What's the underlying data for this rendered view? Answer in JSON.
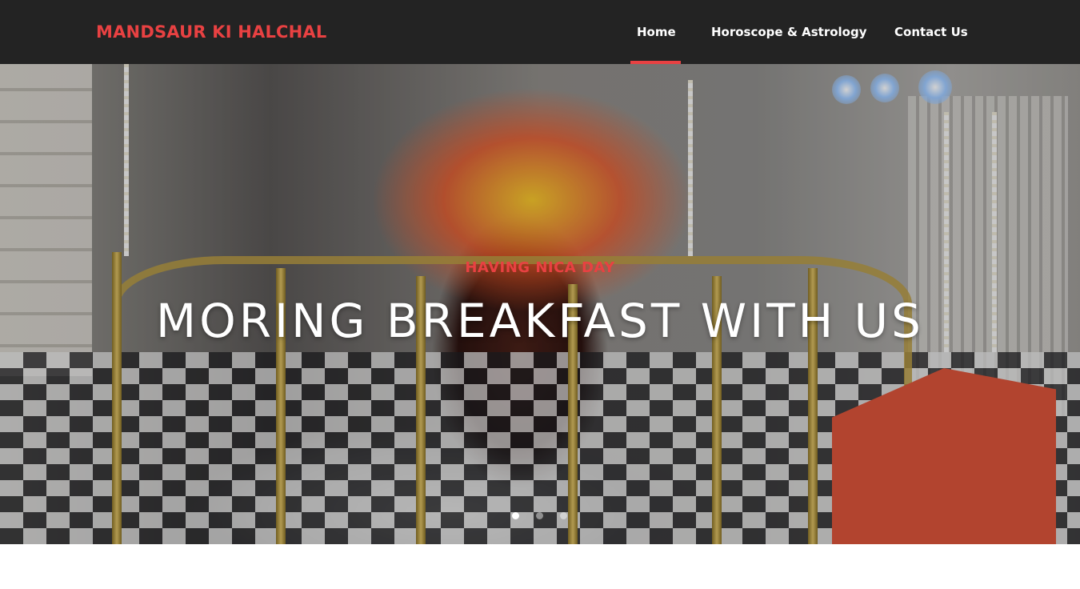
{
  "brand": {
    "name": "MANDSAUR KI HALCHAL"
  },
  "nav": {
    "items": [
      {
        "label": "Home",
        "active": true
      },
      {
        "label": "Horoscope & Astrology",
        "active": false
      },
      {
        "label": "Contact Us",
        "active": false
      }
    ]
  },
  "hero": {
    "subtitle": "Having Nica Day",
    "title": "Moring Breakfast with us",
    "slides_count": 3,
    "active_slide": 1
  },
  "colors": {
    "accent": "#e84142",
    "navbar_bg": "#232323",
    "nav_text": "#ffffff"
  }
}
